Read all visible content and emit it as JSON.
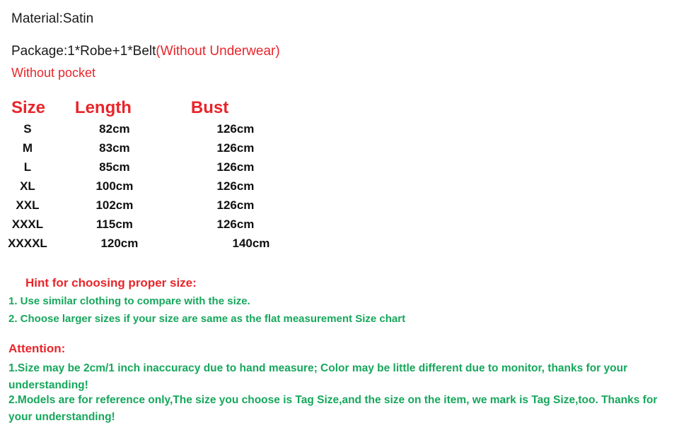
{
  "page": {
    "background_color": "#ffffff",
    "accent_red": "#e8252a",
    "accent_green": "#16a75c",
    "text_black": "#111111"
  },
  "intro": {
    "material_line": "Material:Satin",
    "package_prefix": "Package:1*Robe+1*Belt",
    "package_note": "(Without Underwear)",
    "pocket_note": "Without pocket"
  },
  "size_chart": {
    "headers": [
      "Size",
      "Length",
      "Bust"
    ],
    "rows": [
      {
        "size": "S",
        "length": "82cm",
        "bust": "126cm"
      },
      {
        "size": "M",
        "length": "83cm",
        "bust": "126cm"
      },
      {
        "size": "L",
        "length": "85cm",
        "bust": "126cm"
      },
      {
        "size": "XL",
        "length": "100cm",
        "bust": "126cm"
      },
      {
        "size": "XXL",
        "length": "102cm",
        "bust": "126cm"
      },
      {
        "size": "XXXL",
        "length": "115cm",
        "bust": "126cm"
      },
      {
        "size": "XXXXL",
        "length": "120cm",
        "bust": "140cm"
      }
    ]
  },
  "hint": {
    "title": "Hint for choosing proper size:",
    "line1": "1. Use similar clothing to compare with the size.",
    "line2": "2. Choose larger sizes if your size are same as the flat measurement Size chart"
  },
  "attention": {
    "title": "Attention:",
    "point1": "1.Size may be 2cm/1 inch inaccuracy due to hand measure; Color may be little different   due to monitor, thanks for your understanding!",
    "point2": "2.Models are for reference only,The size you choose is Tag Size,and the size on the item,  we mark is Tag Size,too. Thanks for your understanding!"
  }
}
